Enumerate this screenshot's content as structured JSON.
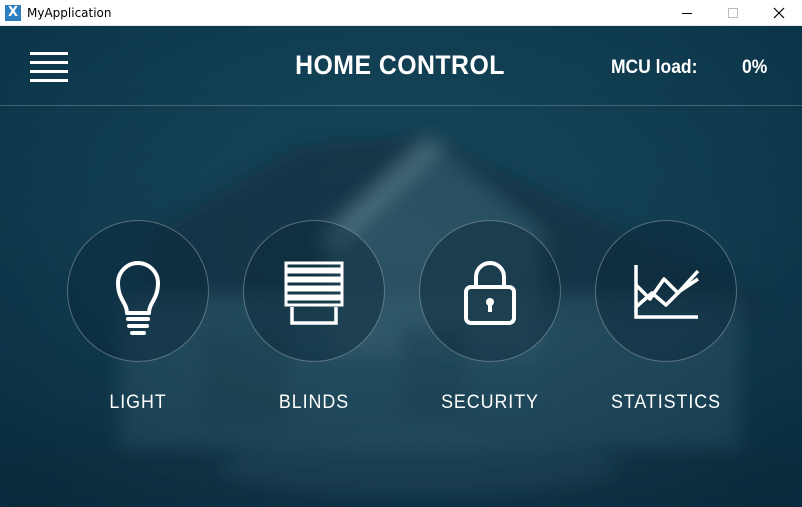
{
  "window": {
    "title": "MyApplication",
    "app_icon_glyph": "X",
    "controls": [
      "minimize-icon",
      "maximize-icon",
      "close-icon"
    ]
  },
  "header": {
    "title": "HOME CONTROL",
    "mcu_label": "MCU load:",
    "mcu_value": "0%",
    "menu_icon": "hamburger-menu-icon"
  },
  "tiles": [
    {
      "label": "LIGHT",
      "icon": "light-bulb-icon"
    },
    {
      "label": "BLINDS",
      "icon": "blinds-icon"
    },
    {
      "label": "SECURITY",
      "icon": "padlock-icon"
    },
    {
      "label": "STATISTICS",
      "icon": "chart-icon"
    }
  ],
  "colors": {
    "background": "#0d3a4e",
    "text": "#ffffff",
    "app_icon": "#2d7fc1"
  }
}
